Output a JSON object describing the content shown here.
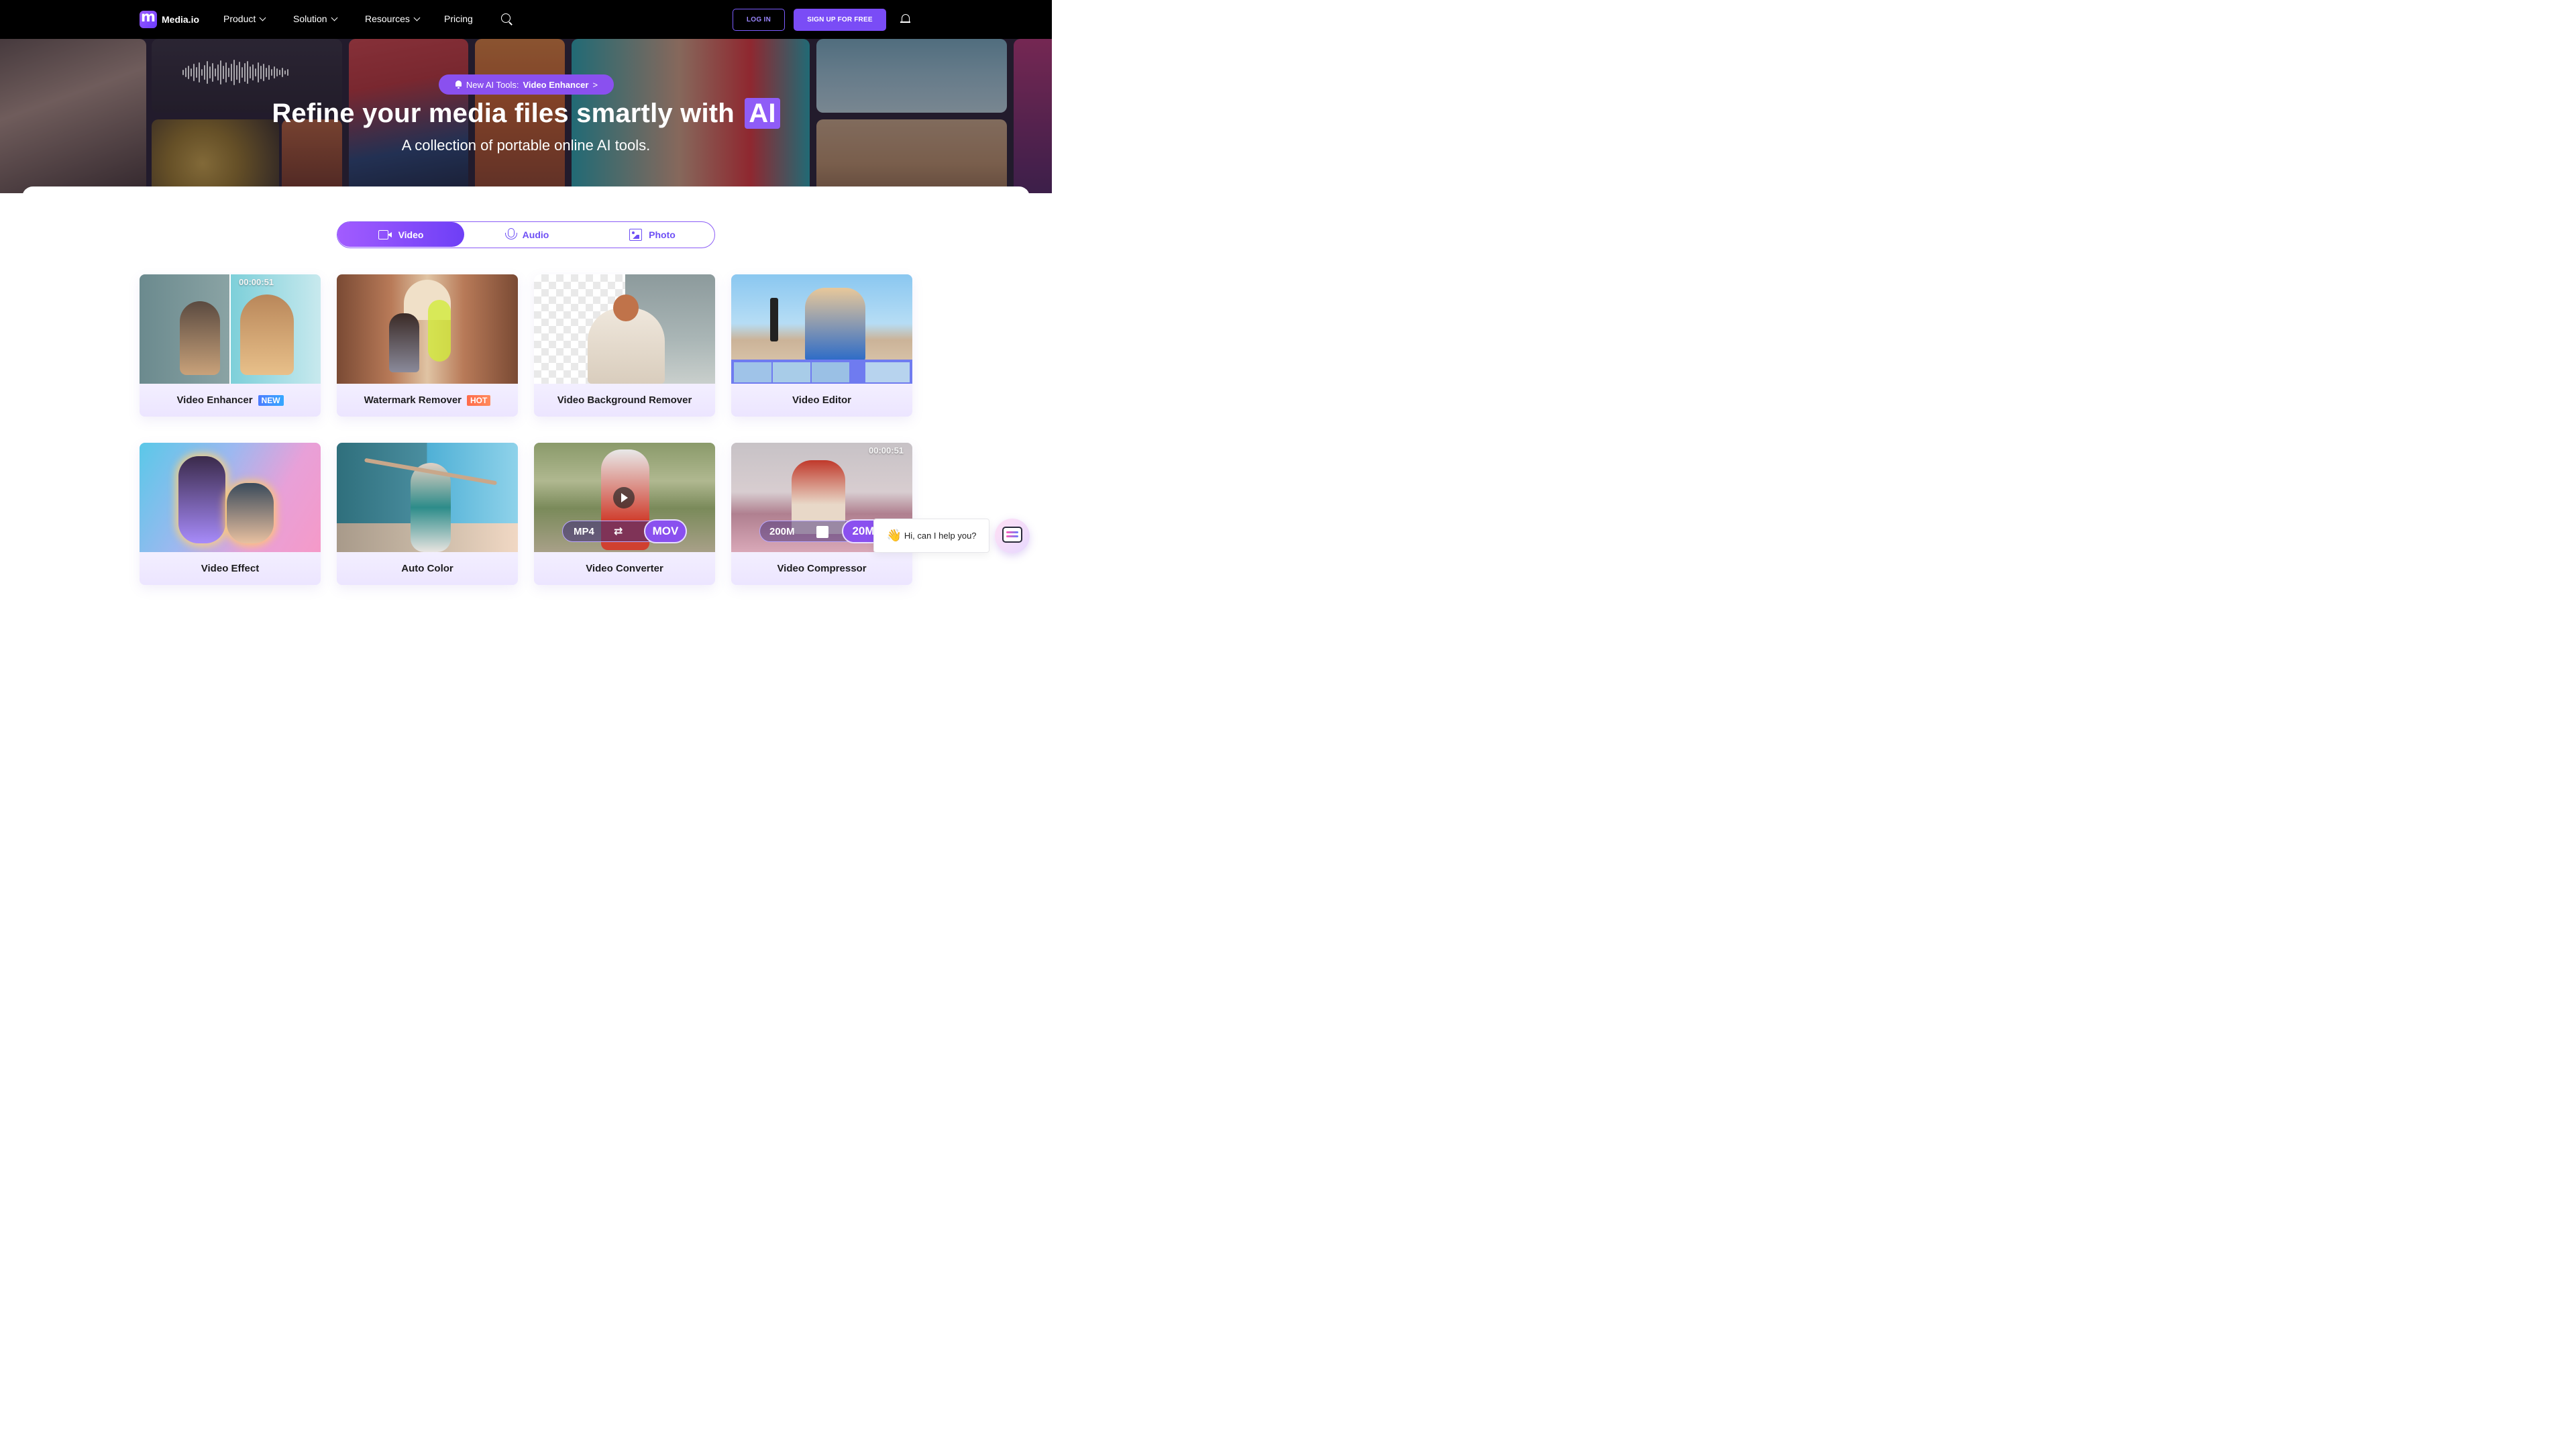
{
  "nav": {
    "brand": "Media.io",
    "items": [
      {
        "label": "Product",
        "dropdown": true
      },
      {
        "label": "Solution",
        "dropdown": true
      },
      {
        "label": "Resources",
        "dropdown": true
      },
      {
        "label": "Pricing",
        "dropdown": false
      }
    ],
    "login_label": "LOG IN",
    "signup_label": "SIGN UP FOR FREE"
  },
  "hero": {
    "pill_prefix": "New AI Tools:",
    "pill_link": "Video Enhancer",
    "pill_arrow": ">",
    "title": "Refine your media files smartly with",
    "title_highlight": "AI",
    "subtitle": "A collection of portable online AI tools."
  },
  "tabs": [
    {
      "label": "Video",
      "icon": "video-icon",
      "active": true
    },
    {
      "label": "Audio",
      "icon": "microphone-icon",
      "active": false
    },
    {
      "label": "Photo",
      "icon": "image-icon",
      "active": false
    }
  ],
  "cards": [
    {
      "title": "Video Enhancer",
      "tag": "NEW",
      "timecode": "00:00:51"
    },
    {
      "title": "Watermark Remover",
      "tag": "HOT"
    },
    {
      "title": "Video Background Remover"
    },
    {
      "title": "Video Editor"
    },
    {
      "title": "Video Effect"
    },
    {
      "title": "Auto Color"
    },
    {
      "title": "Video Converter",
      "format_from": "MP4",
      "format_to": "MOV"
    },
    {
      "title": "Video Compressor",
      "timecode": "00:00:51",
      "size_from": "200M",
      "size_to": "20M"
    }
  ],
  "chat": {
    "greeting": "Hi, can I help you?",
    "emoji": "👋"
  },
  "colors": {
    "accent": "#7a4cf6",
    "nav_bg": "#000000",
    "card_label_bg": "#efe9ff",
    "tag_new": "#3b8cff",
    "tag_hot": "#ff6b4a"
  }
}
